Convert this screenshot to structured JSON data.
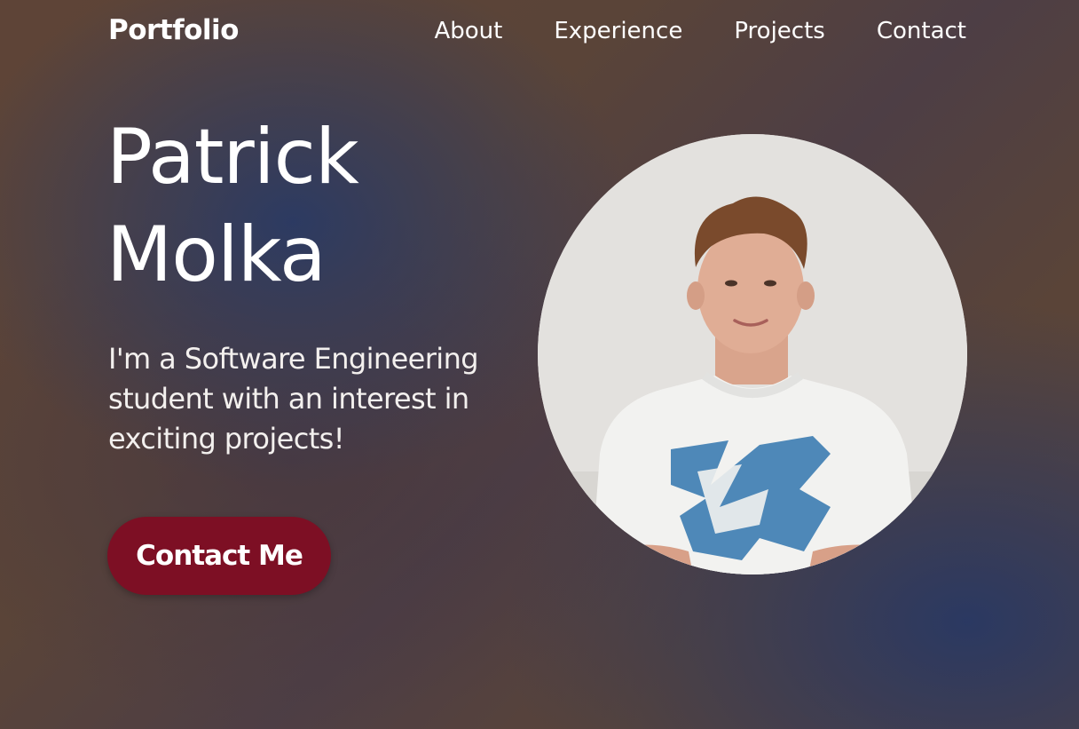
{
  "brand": {
    "logo": "Portfolio"
  },
  "nav": {
    "items": [
      {
        "label": "About"
      },
      {
        "label": "Experience"
      },
      {
        "label": "Projects"
      },
      {
        "label": "Contact"
      }
    ]
  },
  "hero": {
    "first_name": "Patrick",
    "last_name": "Molka",
    "tagline": "I'm a Software Engineering student with an interest in exciting projects!",
    "cta_label": "Contact Me",
    "cta_color": "#7d0f24",
    "photo_icon": "profile-photo"
  }
}
